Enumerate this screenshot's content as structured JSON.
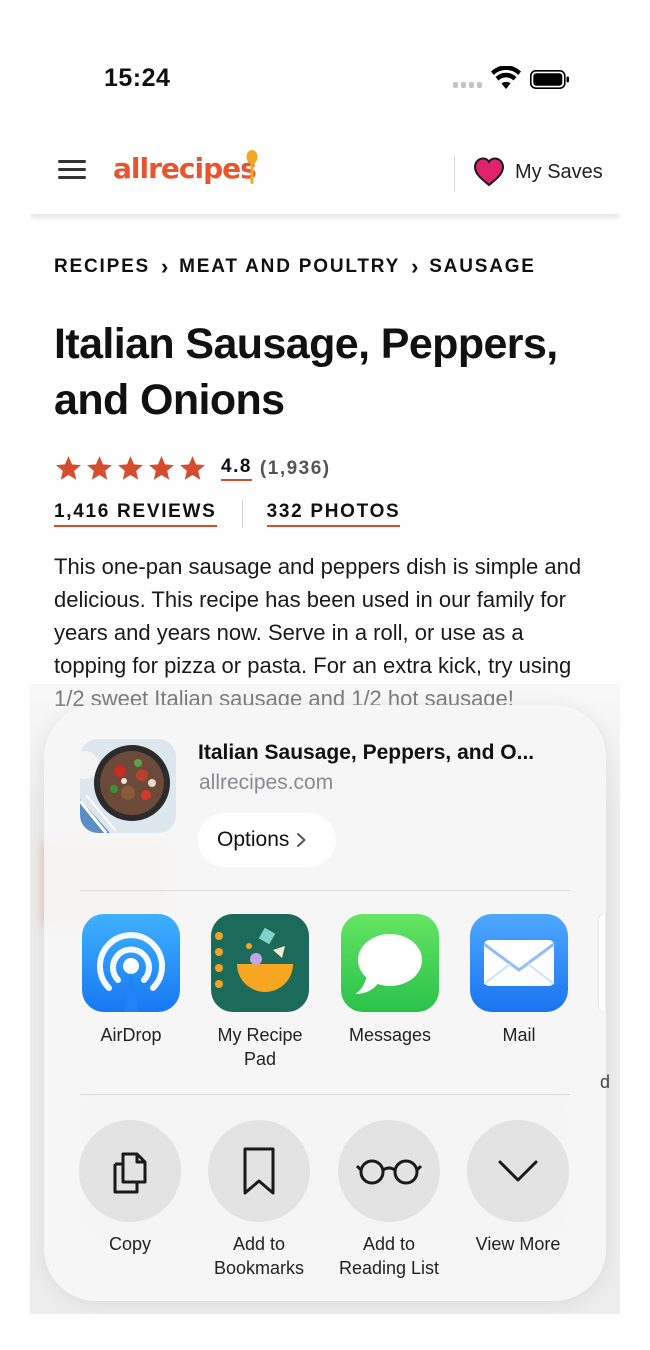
{
  "status_bar": {
    "time": "15:24"
  },
  "site": {
    "logo_text": "allrecipes",
    "saves_label": "My Saves",
    "accent_color": "#e8542d"
  },
  "breadcrumb": [
    "RECIPES",
    "MEAT AND POULTRY",
    "SAUSAGE"
  ],
  "recipe": {
    "title": "Italian Sausage, Peppers, and Onions",
    "rating_value": "4.8",
    "rating_count": "(1,936)",
    "stars": 5,
    "reviews_link": "1,416 REVIEWS",
    "photos_link": "332 PHOTOS",
    "description": "This one-pan sausage and peppers dish is simple and delicious. This recipe has been used in our family for years and years now. Serve in a roll, or use as a topping for pizza or pasta. For an extra kick, try using 1/2 sweet Italian sausage and 1/2 hot sausage!"
  },
  "share_sheet": {
    "title": "Italian Sausage, Peppers, and O...",
    "domain": "allrecipes.com",
    "options_label": "Options",
    "apps": [
      {
        "label": "AirDrop",
        "icon": "airdrop-icon"
      },
      {
        "label": "My Recipe Pad",
        "icon": "recipe-pad-icon"
      },
      {
        "label": "Messages",
        "icon": "messages-icon"
      },
      {
        "label": "Mail",
        "icon": "mail-icon"
      }
    ],
    "next_app_partial_label": "d",
    "actions": [
      {
        "label": "Copy",
        "icon": "copy-icon"
      },
      {
        "label": "Add to Bookmarks",
        "icon": "bookmark-icon"
      },
      {
        "label": "Add to Reading List",
        "icon": "reading-glasses-icon"
      },
      {
        "label": "View More",
        "icon": "chevron-down-icon"
      }
    ]
  }
}
